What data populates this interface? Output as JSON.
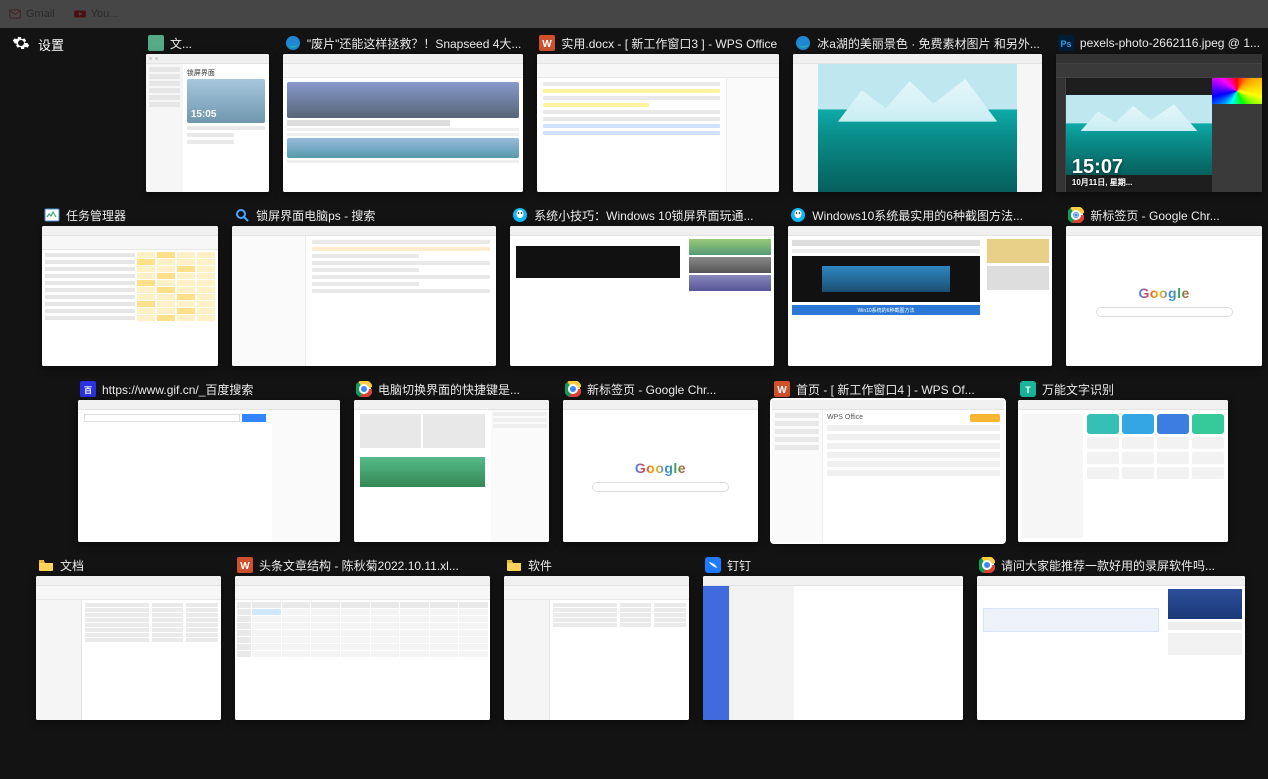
{
  "background_tabs": {
    "gmail": "Gmail",
    "youtube": "You..."
  },
  "header": {
    "settings_label": "设置"
  },
  "row1": [
    {
      "title": "文...",
      "icon": "app",
      "kind": "lockscreen"
    },
    {
      "title": "\"废片\"还能这样拯救？！Snapseed 4大...",
      "icon": "edge",
      "kind": "article"
    },
    {
      "title": "实用.docx - [ 新工作窗口3 ] - WPS Office",
      "icon": "wps-word",
      "kind": "doc"
    },
    {
      "title": "冰a湖的美丽景色 · 免费素材图片 和另外...",
      "icon": "edge",
      "kind": "lake-page"
    },
    {
      "title": "pexels-photo-2662116.jpeg @ 1...",
      "icon": "photoshop",
      "kind": "photoshop"
    }
  ],
  "row2": [
    {
      "title": "任务管理器",
      "icon": "taskmgr",
      "kind": "taskmgr"
    },
    {
      "title": "锁屏界面电脑ps - 搜索",
      "icon": "search",
      "kind": "search"
    },
    {
      "title": "系统小技巧：Windows 10锁屏界面玩通...",
      "icon": "qq",
      "kind": "article2"
    },
    {
      "title": "Windows10系统最实用的6种截图方法...",
      "icon": "qq",
      "kind": "video-article"
    },
    {
      "title": "新标签页 - Google Chr...",
      "icon": "chrome",
      "kind": "newtab"
    }
  ],
  "row3": [
    {
      "title": "https://www.gif.cn/_百度搜索",
      "icon": "baidu",
      "kind": "baidu"
    },
    {
      "title": "电脑切换界面的快捷键是...",
      "icon": "chrome",
      "kind": "article3"
    },
    {
      "title": "新标签页 - Google Chr...",
      "icon": "chrome",
      "kind": "newtab"
    },
    {
      "title": "首页 - [ 新工作窗口4 ] - WPS Of...",
      "icon": "wps-word",
      "kind": "wps-home",
      "selected": true
    },
    {
      "title": "万能文字识别",
      "icon": "ocr",
      "kind": "ocr"
    }
  ],
  "row4": [
    {
      "title": "文档",
      "icon": "folder",
      "kind": "explorer"
    },
    {
      "title": "头条文章结构 - 陈秋菊2022.10.11.xl...",
      "icon": "wps-excel",
      "kind": "excel"
    },
    {
      "title": "软件",
      "icon": "folder",
      "kind": "explorer"
    },
    {
      "title": "钉钉",
      "icon": "dingtalk",
      "kind": "dingtalk"
    },
    {
      "title": "请问大家能推荐一款好用的录屏软件吗...",
      "icon": "chrome",
      "kind": "forum"
    }
  ],
  "misc": {
    "lockscreen_time": "15:05",
    "ps_time": "15:07",
    "ps_date": "10月11日, 星期...",
    "win10_caption": "Win10系统的6种截图方法",
    "wps_logo_text": "WPS Office",
    "settings_page_title": "锁屏界面"
  }
}
